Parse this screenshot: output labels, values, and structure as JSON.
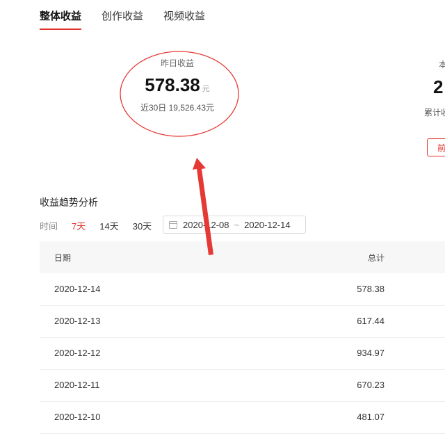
{
  "tabs": [
    {
      "label": "整体收益",
      "active": true
    },
    {
      "label": "创作收益",
      "active": false
    },
    {
      "label": "视频收益",
      "active": false
    }
  ],
  "yesterday": {
    "label": "昨日收益",
    "value": "578.38",
    "unit": "元",
    "sub": "近30日 19,526.43元"
  },
  "right_card": {
    "label": "本",
    "value": "2",
    "sub": "累计收",
    "button": "前"
  },
  "trend": {
    "title": "收益趋势分析",
    "time_label": "时间",
    "options": [
      "7天",
      "14天",
      "30天"
    ],
    "selected": "7天",
    "date_start": "2020-12-08",
    "date_sep": "~",
    "date_end": "2020-12-14"
  },
  "table": {
    "headers": {
      "date": "日期",
      "total": "总计"
    },
    "rows": [
      {
        "date": "2020-12-14",
        "total": "578.38"
      },
      {
        "date": "2020-12-13",
        "total": "617.44"
      },
      {
        "date": "2020-12-12",
        "total": "934.97"
      },
      {
        "date": "2020-12-11",
        "total": "670.23"
      },
      {
        "date": "2020-12-10",
        "total": "481.07"
      }
    ]
  },
  "colors": {
    "accent": "#e0312a",
    "annotation": "#e53935"
  }
}
